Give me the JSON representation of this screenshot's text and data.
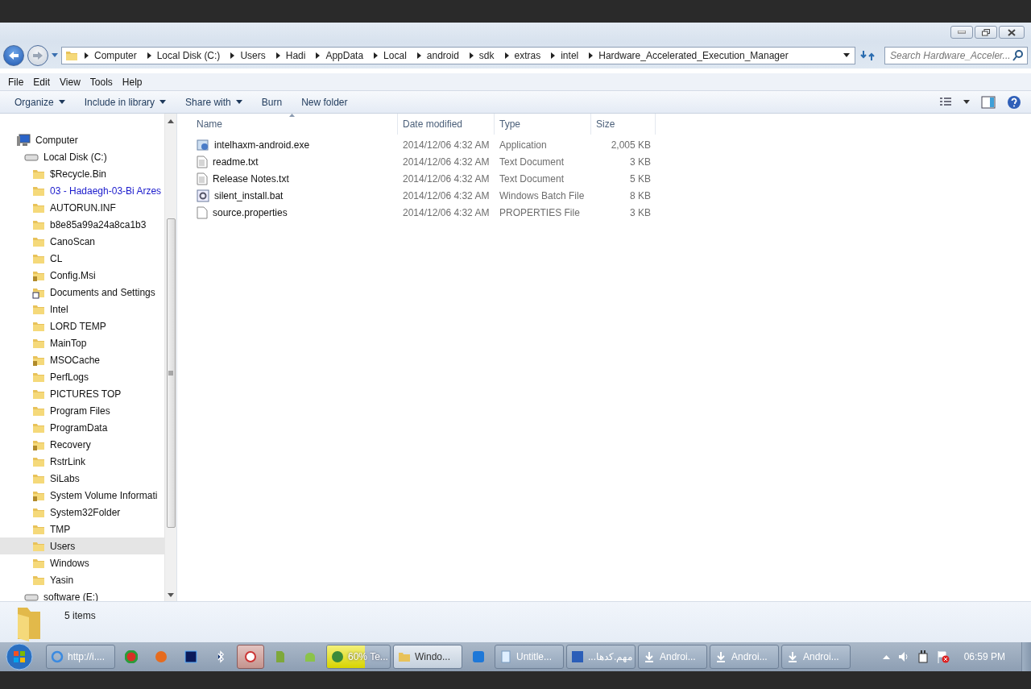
{
  "address_bar": {
    "segments": [
      "Computer",
      "Local Disk (C:)",
      "Users",
      "Hadi",
      "AppData",
      "Local",
      "android",
      "sdk",
      "extras",
      "intel",
      "Hardware_Accelerated_Execution_Manager"
    ]
  },
  "search": {
    "placeholder": "Search Hardware_Acceler..."
  },
  "menu": [
    "File",
    "Edit",
    "View",
    "Tools",
    "Help"
  ],
  "toolbar": [
    {
      "label": "Organize",
      "dropdown": true
    },
    {
      "label": "Include in library",
      "dropdown": true
    },
    {
      "label": "Share with",
      "dropdown": true
    },
    {
      "label": "Burn",
      "dropdown": false
    },
    {
      "label": "New folder",
      "dropdown": false
    }
  ],
  "tree": [
    {
      "label": "Computer",
      "kind": "computer",
      "selected": false,
      "compressed": false,
      "children": [
        {
          "label": "Local Disk (C:)",
          "kind": "drive",
          "selected": false,
          "compressed": false,
          "children": [
            {
              "label": "$Recycle.Bin",
              "kind": "folder",
              "selected": false,
              "compressed": false
            },
            {
              "label": "03 - Hadaegh-03-Bi Arzes",
              "kind": "folder",
              "selected": false,
              "compressed": true
            },
            {
              "label": "AUTORUN.INF",
              "kind": "folder",
              "selected": false,
              "compressed": false
            },
            {
              "label": "b8e85a99a24a8ca1b3",
              "kind": "folder",
              "selected": false,
              "compressed": false
            },
            {
              "label": "CanoScan",
              "kind": "folder",
              "selected": false,
              "compressed": false
            },
            {
              "label": "CL",
              "kind": "folder",
              "selected": false,
              "compressed": false
            },
            {
              "label": "Config.Msi",
              "kind": "locked",
              "selected": false,
              "compressed": false
            },
            {
              "label": "Documents and Settings",
              "kind": "shortcut",
              "selected": false,
              "compressed": false
            },
            {
              "label": "Intel",
              "kind": "folder",
              "selected": false,
              "compressed": false
            },
            {
              "label": "LORD TEMP",
              "kind": "folder",
              "selected": false,
              "compressed": false
            },
            {
              "label": "MainTop",
              "kind": "folder",
              "selected": false,
              "compressed": false
            },
            {
              "label": "MSOCache",
              "kind": "locked",
              "selected": false,
              "compressed": false
            },
            {
              "label": "PerfLogs",
              "kind": "folder",
              "selected": false,
              "compressed": false
            },
            {
              "label": "PICTURES TOP",
              "kind": "folder",
              "selected": false,
              "compressed": false
            },
            {
              "label": "Program Files",
              "kind": "folder",
              "selected": false,
              "compressed": false
            },
            {
              "label": "ProgramData",
              "kind": "folder",
              "selected": false,
              "compressed": false
            },
            {
              "label": "Recovery",
              "kind": "locked",
              "selected": false,
              "compressed": false
            },
            {
              "label": "RstrLink",
              "kind": "folder",
              "selected": false,
              "compressed": false
            },
            {
              "label": "SiLabs",
              "kind": "folder",
              "selected": false,
              "compressed": false
            },
            {
              "label": "System Volume Informati",
              "kind": "locked",
              "selected": false,
              "compressed": false
            },
            {
              "label": "System32Folder",
              "kind": "folder",
              "selected": false,
              "compressed": false
            },
            {
              "label": "TMP",
              "kind": "folder",
              "selected": false,
              "compressed": false
            },
            {
              "label": "Users",
              "kind": "folder",
              "selected": true,
              "compressed": false
            },
            {
              "label": "Windows",
              "kind": "folder",
              "selected": false,
              "compressed": false
            },
            {
              "label": "Yasin",
              "kind": "folder",
              "selected": false,
              "compressed": false
            }
          ]
        },
        {
          "label": "software (E:)",
          "kind": "drive",
          "selected": false,
          "compressed": false
        }
      ]
    }
  ],
  "table": {
    "columns": [
      "Name",
      "Date modified",
      "Type",
      "Size"
    ],
    "rows": [
      {
        "kind": "exe",
        "cells": [
          "intelhaxm-android.exe",
          "2014/12/06 4:32 AM",
          "Application",
          "2,005 KB"
        ]
      },
      {
        "kind": "text",
        "cells": [
          "readme.txt",
          "2014/12/06 4:32 AM",
          "Text Document",
          "3 KB"
        ]
      },
      {
        "kind": "text",
        "cells": [
          "Release Notes.txt",
          "2014/12/06 4:32 AM",
          "Text Document",
          "5 KB"
        ]
      },
      {
        "kind": "bat",
        "cells": [
          "silent_install.bat",
          "2014/12/06 4:32 AM",
          "Windows Batch File",
          "8 KB"
        ]
      },
      {
        "kind": "file",
        "cells": [
          "source.properties",
          "2014/12/06 4:32 AM",
          "PROPERTIES File",
          "3 KB"
        ]
      }
    ]
  },
  "status_bar": {
    "text": "5 items"
  },
  "taskbar": {
    "items": [
      {
        "kind": "window",
        "label": "http://i....",
        "selected": false
      },
      {
        "kind": "pinned",
        "selected": false
      },
      {
        "kind": "pinned",
        "selected": false
      },
      {
        "kind": "pinned",
        "selected": false
      },
      {
        "kind": "pinned",
        "selected": false
      },
      {
        "kind": "pinned",
        "selected": true
      },
      {
        "kind": "pinned",
        "selected": false
      },
      {
        "kind": "pinned",
        "selected": false
      },
      {
        "kind": "progress",
        "label": "60% Te...",
        "level": 0.6,
        "selected": false
      },
      {
        "kind": "window",
        "label": "Windo...",
        "selected": true
      },
      {
        "kind": "pinned",
        "selected": false
      },
      {
        "kind": "window",
        "label": "Untitle...",
        "selected": false
      },
      {
        "kind": "window",
        "label": "مهم.كدها...",
        "selected": false
      },
      {
        "kind": "window",
        "label": "Androi...",
        "selected": false
      },
      {
        "kind": "window",
        "label": "Androi...",
        "selected": false
      },
      {
        "kind": "window",
        "label": "Androi...",
        "selected": false
      }
    ],
    "clock": "06:59 PM"
  }
}
